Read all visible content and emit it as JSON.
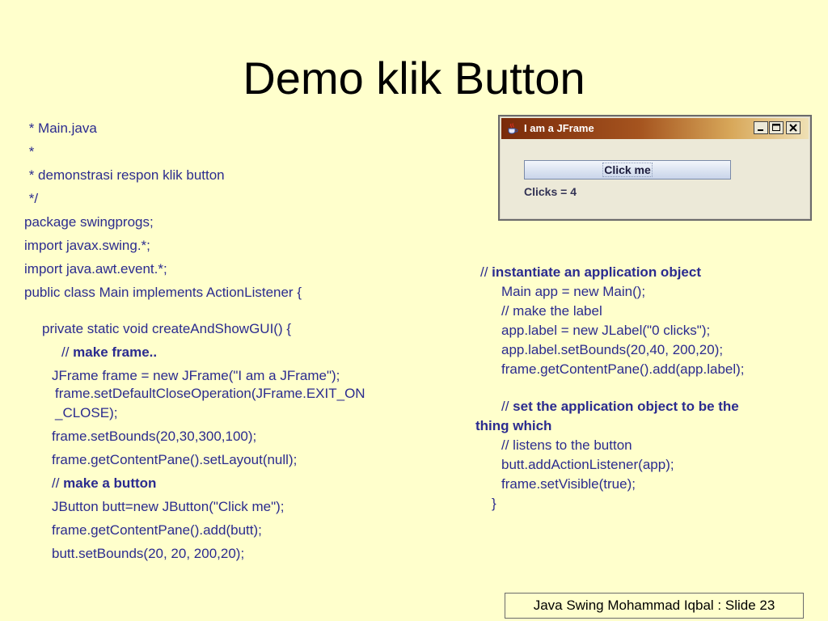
{
  "slide": {
    "title": "Demo klik Button",
    "footer": "Java Swing Mohammad Iqbal : Slide 23"
  },
  "code_left": [
    {
      "indent": 1,
      "parts": [
        {
          "t": " * Main.java"
        }
      ]
    },
    {
      "indent": 1,
      "parts": [
        {
          "t": " *"
        }
      ]
    },
    {
      "indent": 1,
      "parts": [
        {
          "t": " * demonstrasi respon klik button"
        }
      ]
    },
    {
      "indent": 1,
      "parts": [
        {
          "t": " */"
        }
      ]
    },
    {
      "indent": 0,
      "parts": [
        {
          "t": "package swingprogs;"
        }
      ]
    },
    {
      "indent": 0,
      "parts": [
        {
          "t": "import javax.swing.*;"
        }
      ]
    },
    {
      "indent": 0,
      "parts": [
        {
          "t": "import java.awt.event.*;"
        }
      ]
    },
    {
      "indent": 0,
      "parts": [
        {
          "t": "public class Main implements ActionListener {"
        }
      ]
    },
    {
      "indent": 0,
      "parts": [
        {
          "t": ""
        }
      ]
    },
    {
      "indent": 22,
      "parts": [
        {
          "t": "private static void createAndShowGUI() {"
        }
      ]
    },
    {
      "indent": 46,
      "parts": [
        {
          "t": "// "
        },
        {
          "t": "make frame..",
          "b": true
        }
      ]
    },
    {
      "indent": 34,
      "parts": [
        {
          "t": "JFrame frame = new JFrame(\"I am a JFrame\");"
        }
      ]
    },
    {
      "indent": 38,
      "parts": [
        {
          "t": "frame.setDefaultCloseOperation(JFrame.EXIT_ON"
        }
      ]
    },
    {
      "indent": 38,
      "parts": [
        {
          "t": "_CLOSE);"
        }
      ]
    },
    {
      "indent": 34,
      "parts": [
        {
          "t": "frame.setBounds(20,30,300,100);"
        }
      ]
    },
    {
      "indent": 34,
      "parts": [
        {
          "t": "frame.getContentPane().setLayout(null);"
        }
      ]
    },
    {
      "indent": 34,
      "parts": [
        {
          "t": "// "
        },
        {
          "t": "make a button",
          "b": true
        }
      ]
    },
    {
      "indent": 34,
      "parts": [
        {
          "t": "JButton butt=new JButton(\"Click me\");"
        }
      ]
    },
    {
      "indent": 34,
      "parts": [
        {
          "t": "frame.getContentPane().add(butt);"
        }
      ]
    },
    {
      "indent": 34,
      "parts": [
        {
          "t": "butt.setBounds(20, 20, 200,20);"
        }
      ]
    }
  ],
  "code_right": [
    {
      "indent": 6,
      "parts": [
        {
          "t": "// "
        },
        {
          "t": "instantiate an application object",
          "b": true
        }
      ]
    },
    {
      "indent": 32,
      "parts": [
        {
          "t": "Main app = new Main();"
        }
      ]
    },
    {
      "indent": 32,
      "parts": [
        {
          "t": "// make the label"
        }
      ]
    },
    {
      "indent": 32,
      "parts": [
        {
          "t": "app.label = new JLabel(\"0 clicks\");"
        }
      ]
    },
    {
      "indent": 32,
      "parts": [
        {
          "t": "app.label.setBounds(20,40, 200,20);"
        }
      ]
    },
    {
      "indent": 32,
      "parts": [
        {
          "t": "frame.getContentPane().add(app.label);"
        }
      ]
    },
    {
      "indent": 0,
      "parts": [
        {
          "t": ""
        }
      ]
    },
    {
      "indent": 32,
      "parts": [
        {
          "t": "// "
        },
        {
          "t": "set the application object to be the",
          "b": true
        }
      ]
    },
    {
      "indent": 0,
      "parts": [
        {
          "t": "thing which",
          "b": true
        }
      ]
    },
    {
      "indent": 32,
      "parts": [
        {
          "t": "// listens to the button"
        }
      ]
    },
    {
      "indent": 32,
      "parts": [
        {
          "t": "butt.addActionListener(app);"
        }
      ]
    },
    {
      "indent": 32,
      "parts": [
        {
          "t": "frame.setVisible(true);"
        }
      ]
    },
    {
      "indent": 20,
      "parts": [
        {
          "t": "}"
        }
      ]
    }
  ],
  "jframe": {
    "title": "I am a JFrame",
    "button_label": "Click me",
    "label_text": "Clicks = 4"
  }
}
